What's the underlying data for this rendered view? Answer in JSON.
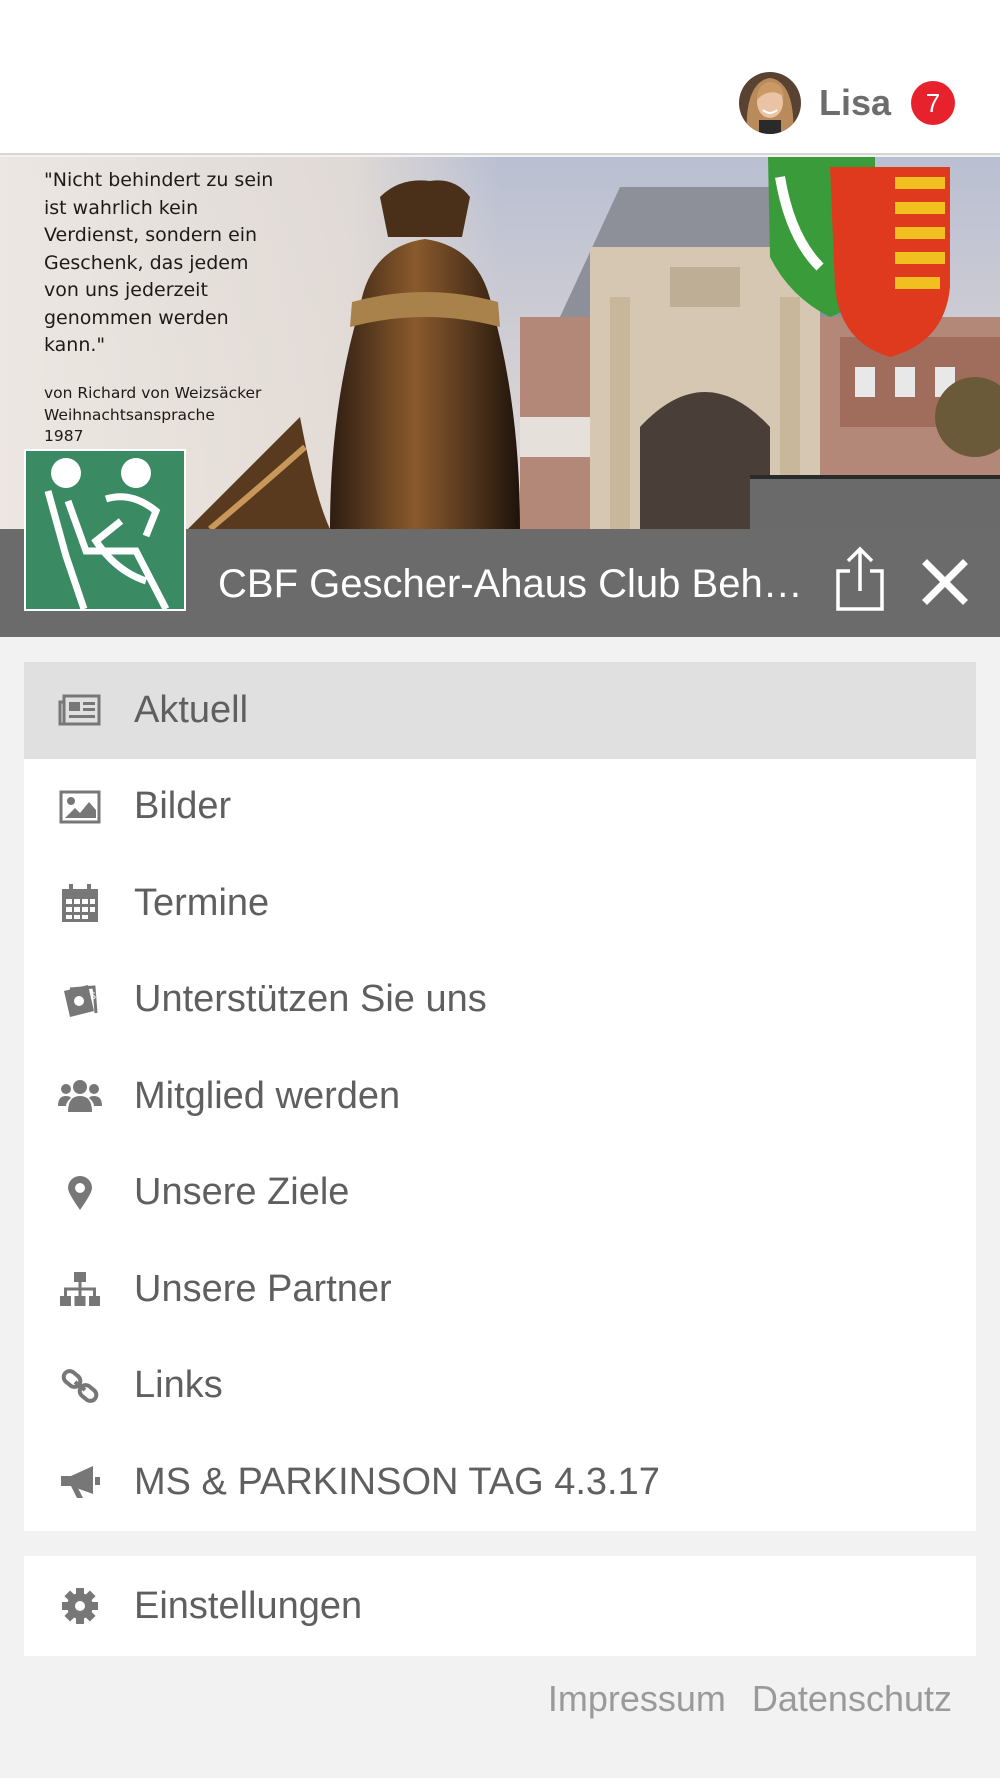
{
  "header": {
    "user_name": "Lisa",
    "notification_count": "7"
  },
  "banner": {
    "quote": "\"Nicht behindert zu sein\nist wahrlich kein\nVerdienst, sondern ein\nGeschenk, das jedem\nvon uns jederzeit\ngenommen werden\nkann.\"",
    "attribution": "von Richard von Weizsäcker\nWeihnachtsansprache\n1987"
  },
  "titlebar": {
    "title": "CBF Gescher-Ahaus Club Behinderter und ihrer Freunde"
  },
  "menu": {
    "items": [
      {
        "label": "Aktuell",
        "icon": "newspaper-icon",
        "active": true
      },
      {
        "label": "Bilder",
        "icon": "image-icon"
      },
      {
        "label": "Termine",
        "icon": "calendar-icon"
      },
      {
        "label": "Unterstützen Sie uns",
        "icon": "money-icon"
      },
      {
        "label": "Mitglied werden",
        "icon": "users-icon"
      },
      {
        "label": "Unsere Ziele",
        "icon": "map-marker-icon"
      },
      {
        "label": "Unsere Partner",
        "icon": "sitemap-icon"
      },
      {
        "label": "Links",
        "icon": "link-icon"
      },
      {
        "label": "MS & PARKINSON TAG 4.3.17",
        "icon": "megaphone-icon"
      }
    ],
    "settings": {
      "label": "Einstellungen",
      "icon": "gear-icon"
    }
  },
  "footer": {
    "impressum": "Impressum",
    "datenschutz": "Datenschutz"
  },
  "colors": {
    "badge": "#e8222c",
    "titlebar": "#6b6b6b",
    "active_item": "#e0e0e0",
    "logo_green": "#3a8a63"
  }
}
